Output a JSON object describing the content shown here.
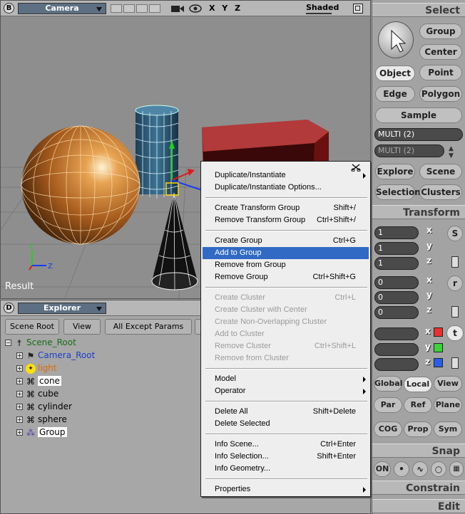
{
  "viewport_b": {
    "letter": "B",
    "camera": "Camera",
    "axes": "X Y Z",
    "shade": "Shaded",
    "result": "Result"
  },
  "viewport_d": {
    "letter": "D",
    "title": "Explorer",
    "buttons": [
      "Scene Root",
      "View",
      "All Except Params"
    ]
  },
  "tree": [
    {
      "label": "Scene_Root",
      "color": "#1a6b1a",
      "icon": "person-icon"
    },
    {
      "label": "Camera_Root",
      "color": "#1e3ec8",
      "icon": "camera-icon"
    },
    {
      "label": "light",
      "color": "#e06a00",
      "icon": "light-icon"
    },
    {
      "label": "cone",
      "color": "#000",
      "icon": "mesh-icon"
    },
    {
      "label": "cube",
      "color": "#000",
      "icon": "mesh-icon"
    },
    {
      "label": "cylinder",
      "color": "#000",
      "icon": "mesh-icon"
    },
    {
      "label": "sphere",
      "color": "#000",
      "icon": "mesh-icon"
    },
    {
      "label": "Group",
      "color": "#000",
      "icon": "group-icon"
    }
  ],
  "menu": [
    {
      "label": "Duplicate/Instantiate",
      "shortcut": "",
      "sub": true
    },
    {
      "label": "Duplicate/Instantiate Options...",
      "shortcut": ""
    },
    {
      "sep": true
    },
    {
      "label": "Create Transform Group",
      "shortcut": "Shift+/"
    },
    {
      "label": "Remove Transform Group",
      "shortcut": "Ctrl+Shift+/"
    },
    {
      "sep": true
    },
    {
      "label": "Create Group",
      "shortcut": "Ctrl+G"
    },
    {
      "label": "Add to Group",
      "shortcut": "",
      "selected": true
    },
    {
      "label": "Remove from Group",
      "shortcut": ""
    },
    {
      "label": "Remove Group",
      "shortcut": "Ctrl+Shift+G"
    },
    {
      "sep": true
    },
    {
      "label": "Create Cluster",
      "shortcut": "Ctrl+L",
      "disabled": true
    },
    {
      "label": "Create Cluster with Center",
      "shortcut": "",
      "disabled": true
    },
    {
      "label": "Create Non-Overlapping Cluster",
      "shortcut": "",
      "disabled": true
    },
    {
      "label": "Add to Cluster",
      "shortcut": "",
      "disabled": true
    },
    {
      "label": "Remove Cluster",
      "shortcut": "Ctrl+Shift+L",
      "disabled": true
    },
    {
      "label": "Remove from Cluster",
      "shortcut": "",
      "disabled": true
    },
    {
      "sep": true
    },
    {
      "label": "Model",
      "shortcut": "",
      "sub": true
    },
    {
      "label": "Operator",
      "shortcut": "",
      "sub": true
    },
    {
      "sep": true
    },
    {
      "label": "Delete All",
      "shortcut": "Shift+Delete"
    },
    {
      "label": "Delete Selected",
      "shortcut": ""
    },
    {
      "sep": true
    },
    {
      "label": "Info Scene...",
      "shortcut": "Ctrl+Enter"
    },
    {
      "label": "Info Selection...",
      "shortcut": "Shift+Enter"
    },
    {
      "label": "Info Geometry...",
      "shortcut": ""
    },
    {
      "sep": true
    },
    {
      "label": "Properties",
      "shortcut": "",
      "sub": true
    }
  ],
  "panel": {
    "select": "Select",
    "group": "Group",
    "center": "Center",
    "object": "Object",
    "point": "Point",
    "edge": "Edge",
    "polygon": "Polygon",
    "sample": "Sample",
    "multi1": "MULTI (2)",
    "multi2": "MULTI (2)",
    "explore": "Explore",
    "scene": "Scene",
    "selection": "Selection",
    "clusters": "Clusters",
    "transform": "Transform",
    "scale": [
      "1",
      "1",
      "1"
    ],
    "rot": [
      "0",
      "0",
      "0"
    ],
    "letters": {
      "x": "x",
      "y": "y",
      "z": "z",
      "s": "S",
      "r": "r",
      "t": "t"
    },
    "global": "Global",
    "local": "Local",
    "view": "View",
    "par": "Par",
    "ref": "Ref",
    "plane": "Plane",
    "cog": "COG",
    "prop": "Prop",
    "sym": "Sym",
    "snap": "Snap",
    "on": "ON",
    "constrain": "Constrain",
    "edit": "Edit"
  }
}
